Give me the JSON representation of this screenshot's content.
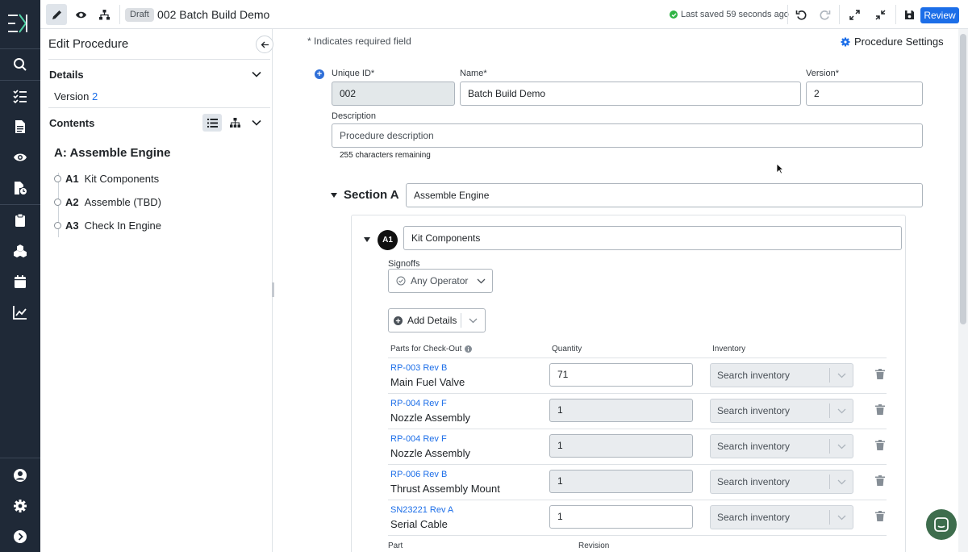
{
  "topbar": {
    "draft_badge": "Draft",
    "title": "002 Batch Build Demo",
    "saved_status": "Last saved 59 seconds ago",
    "review_label": "Review"
  },
  "sidebar_nav": {
    "icons": [
      "search-icon",
      "checklist-icon",
      "document-icon",
      "eye-icon",
      "document-clock-icon",
      "clipboard-icon",
      "components-icon",
      "calendar-icon",
      "analytics-icon",
      "user-icon",
      "gear-icon",
      "expand-icon"
    ]
  },
  "panel": {
    "title": "Edit Procedure",
    "details_label": "Details",
    "version_label": "Version",
    "version_value": "2",
    "contents_label": "Contents",
    "section_title": "A: Assemble Engine",
    "steps": [
      {
        "code": "A1",
        "name": "Kit Components"
      },
      {
        "code": "A2",
        "name": "Assemble (TBD)"
      },
      {
        "code": "A3",
        "name": "Check In Engine"
      }
    ]
  },
  "form": {
    "required_note": "* Indicates required field",
    "settings_label": "Procedure Settings",
    "unique_id_label": "Unique ID*",
    "unique_id_value": "002",
    "name_label": "Name*",
    "name_value": "Batch Build Demo",
    "version_label": "Version*",
    "version_value": "2",
    "description_label": "Description",
    "description_placeholder": "Procedure description",
    "chars_remaining": "255 characters remaining"
  },
  "section": {
    "label": "Section A",
    "name": "Assemble Engine"
  },
  "step": {
    "badge": "A1",
    "name": "Kit Components",
    "signoffs_label": "Signoffs",
    "signoff_value": "Any Operator",
    "add_details_label": "Add Details",
    "table_headers": {
      "parts": "Parts for Check-Out",
      "quantity": "Quantity",
      "inventory": "Inventory"
    },
    "parts": [
      {
        "id": "RP-003 Rev B",
        "name": "Main Fuel Valve",
        "qty": "71",
        "qty_disabled": false,
        "inventory_placeholder": "Search inventory"
      },
      {
        "id": "RP-004 Rev F",
        "name": "Nozzle Assembly",
        "qty": "1",
        "qty_disabled": true,
        "inventory_placeholder": "Search inventory"
      },
      {
        "id": "RP-004 Rev F",
        "name": "Nozzle Assembly",
        "qty": "1",
        "qty_disabled": true,
        "inventory_placeholder": "Search inventory"
      },
      {
        "id": "RP-006 Rev B",
        "name": "Thrust Assembly Mount",
        "qty": "1",
        "qty_disabled": true,
        "inventory_placeholder": "Search inventory"
      },
      {
        "id": "SN23221 Rev A",
        "name": "Serial Cable",
        "qty": "1",
        "qty_disabled": false,
        "inventory_placeholder": "Search inventory"
      }
    ],
    "footer_headers": {
      "part": "Part",
      "revision": "Revision"
    }
  },
  "colors": {
    "rail": "#1f2937",
    "accent": "#1c6ee8",
    "success": "#2fb344",
    "chat": "#3e6d4d"
  }
}
